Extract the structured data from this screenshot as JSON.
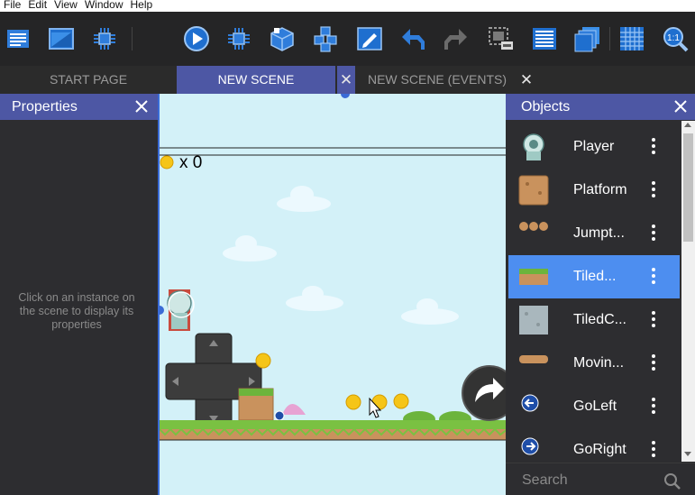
{
  "menu": {
    "items": [
      "File",
      "Edit",
      "View",
      "Window",
      "Help"
    ]
  },
  "toolbar": {
    "buttons": [
      "project-manager-icon",
      "scene-icon",
      "object-editor-icon",
      "preview-icon",
      "network-preview-icon",
      "object-icon",
      "objects-group-icon",
      "edit-icon",
      "undo-icon",
      "redo-icon",
      "layers-icon",
      "list-icon",
      "instances-icon",
      "grid-icon",
      "zoom-icon"
    ]
  },
  "tabs": [
    {
      "label": "START PAGE",
      "active": false
    },
    {
      "label": "NEW SCENE",
      "active": true
    },
    {
      "label": "NEW SCENE (EVENTS)",
      "active": false
    }
  ],
  "properties": {
    "title": "Properties",
    "empty_message": "Click on an instance on the scene to display its properties"
  },
  "scene": {
    "coin_counter": "x 0"
  },
  "objects": {
    "title": "Objects",
    "items": [
      {
        "name": "Player",
        "icon": "player-icon"
      },
      {
        "name": "Platform",
        "icon": "platform-icon"
      },
      {
        "name": "Jumpt...",
        "icon": "jumpthru-icon"
      },
      {
        "name": "Tiled...",
        "icon": "tiled-grass-icon"
      },
      {
        "name": "TiledC...",
        "icon": "tiled-castle-icon"
      },
      {
        "name": "Movin...",
        "icon": "moving-platform-icon"
      },
      {
        "name": "GoLeft",
        "icon": "go-left-icon"
      },
      {
        "name": "GoRight",
        "icon": "go-right-icon"
      }
    ],
    "selected_index": 3,
    "search_placeholder": "Search"
  },
  "colors": {
    "accent": "#4d57a4",
    "selection": "#4d8ef0",
    "sky": "#d3f1f8",
    "panel_bg": "#2d2d30"
  }
}
